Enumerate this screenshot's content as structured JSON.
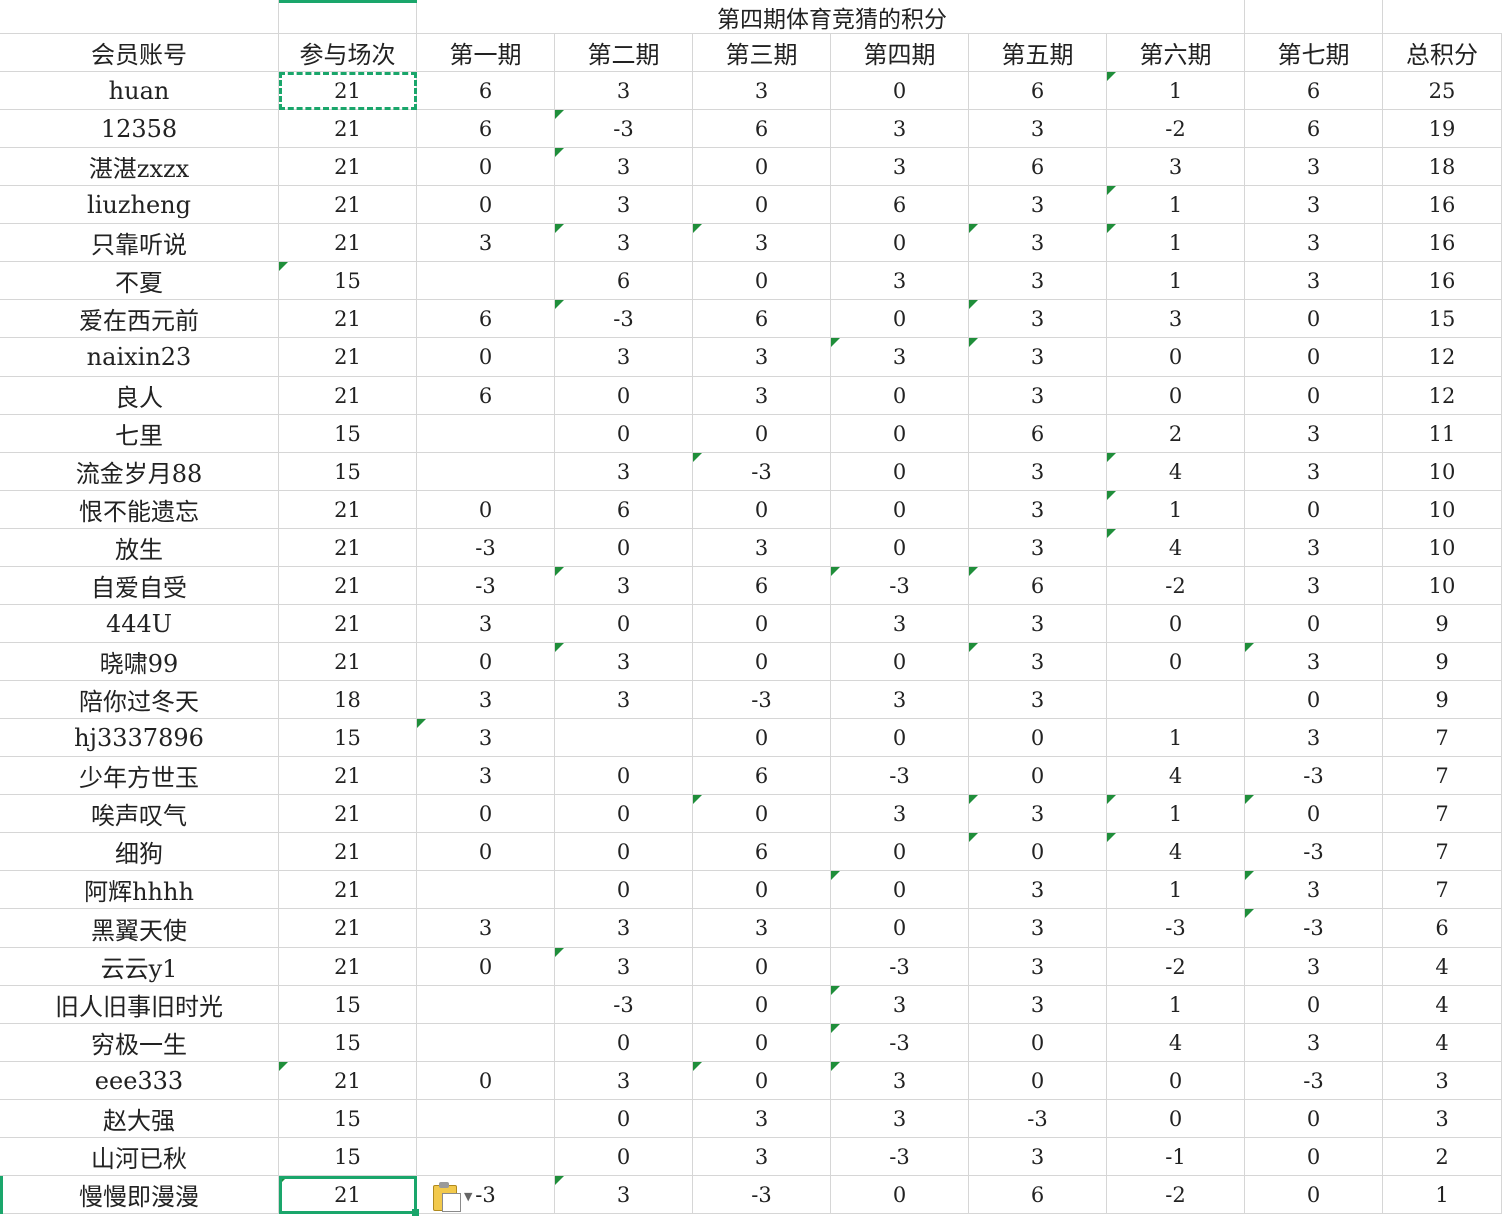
{
  "sheet": {
    "title": "第四期体育竞猜的积分",
    "headers": [
      "会员账号",
      "参与场次",
      "第一期",
      "第二期",
      "第三期",
      "第四期",
      "第五期",
      "第六期",
      "第七期",
      "总积分"
    ],
    "rows": [
      [
        "huan",
        "21",
        "6",
        "3",
        "3",
        "0",
        "6",
        "1",
        "6",
        "25"
      ],
      [
        "12358",
        "21",
        "6",
        "-3",
        "6",
        "3",
        "3",
        "-2",
        "6",
        "19"
      ],
      [
        "湛湛zxzx",
        "21",
        "0",
        "3",
        "0",
        "3",
        "6",
        "3",
        "3",
        "18"
      ],
      [
        "liuzheng",
        "21",
        "0",
        "3",
        "0",
        "6",
        "3",
        "1",
        "3",
        "16"
      ],
      [
        "只靠听说",
        "21",
        "3",
        "3",
        "3",
        "0",
        "3",
        "1",
        "3",
        "16"
      ],
      [
        "不夏",
        "15",
        "",
        "6",
        "0",
        "3",
        "3",
        "1",
        "3",
        "16"
      ],
      [
        "爱在西元前",
        "21",
        "6",
        "-3",
        "6",
        "0",
        "3",
        "3",
        "0",
        "15"
      ],
      [
        "naixin23",
        "21",
        "0",
        "3",
        "3",
        "3",
        "3",
        "0",
        "0",
        "12"
      ],
      [
        "良人",
        "21",
        "6",
        "0",
        "3",
        "0",
        "3",
        "0",
        "0",
        "12"
      ],
      [
        "七里",
        "15",
        "",
        "0",
        "0",
        "0",
        "6",
        "2",
        "3",
        "11"
      ],
      [
        "流金岁月88",
        "15",
        "",
        "3",
        "-3",
        "0",
        "3",
        "4",
        "3",
        "10"
      ],
      [
        "恨不能遗忘",
        "21",
        "0",
        "6",
        "0",
        "0",
        "3",
        "1",
        "0",
        "10"
      ],
      [
        "放生",
        "21",
        "-3",
        "0",
        "3",
        "0",
        "3",
        "4",
        "3",
        "10"
      ],
      [
        "自爱自受",
        "21",
        "-3",
        "3",
        "6",
        "-3",
        "6",
        "-2",
        "3",
        "10"
      ],
      [
        "444U",
        "21",
        "3",
        "0",
        "0",
        "3",
        "3",
        "0",
        "0",
        "9"
      ],
      [
        "晓啸99",
        "21",
        "0",
        "3",
        "0",
        "0",
        "3",
        "0",
        "3",
        "9"
      ],
      [
        "陪你过冬天",
        "18",
        "3",
        "3",
        "-3",
        "3",
        "3",
        "",
        "0",
        "9"
      ],
      [
        "hj3337896",
        "15",
        "3",
        "",
        "0",
        "0",
        "0",
        "1",
        "3",
        "7"
      ],
      [
        "少年方世玉",
        "21",
        "3",
        "0",
        "6",
        "-3",
        "0",
        "4",
        "-3",
        "7"
      ],
      [
        "唉声叹气",
        "21",
        "0",
        "0",
        "0",
        "3",
        "3",
        "1",
        "0",
        "7"
      ],
      [
        "细狗",
        "21",
        "0",
        "0",
        "6",
        "0",
        "0",
        "4",
        "-3",
        "7"
      ],
      [
        "阿辉hhhh",
        "21",
        "",
        "0",
        "0",
        "0",
        "3",
        "1",
        "3",
        "7"
      ],
      [
        "黑翼天使",
        "21",
        "3",
        "3",
        "3",
        "0",
        "3",
        "-3",
        "-3",
        "6"
      ],
      [
        "云云y1",
        "21",
        "0",
        "3",
        "0",
        "-3",
        "3",
        "-2",
        "3",
        "4"
      ],
      [
        "旧人旧事旧时光",
        "15",
        "",
        "-3",
        "0",
        "3",
        "3",
        "1",
        "0",
        "4"
      ],
      [
        "穷极一生",
        "15",
        "",
        "0",
        "0",
        "-3",
        "0",
        "4",
        "3",
        "4"
      ],
      [
        "eee333",
        "21",
        "0",
        "3",
        "0",
        "3",
        "0",
        "0",
        "-3",
        "3"
      ],
      [
        "赵大强",
        "15",
        "",
        "0",
        "3",
        "3",
        "-3",
        "0",
        "0",
        "3"
      ],
      [
        "山河已秋",
        "15",
        "",
        "0",
        "3",
        "-3",
        "3",
        "-1",
        "0",
        "2"
      ],
      [
        "慢慢即漫漫",
        "21",
        "-3",
        "3",
        "-3",
        "0",
        "6",
        "-2",
        "0",
        "1"
      ]
    ],
    "comment_marks": [
      [
        1,
        7
      ],
      [
        2,
        3
      ],
      [
        3,
        3
      ],
      [
        4,
        7
      ],
      [
        5,
        3
      ],
      [
        5,
        4
      ],
      [
        5,
        6
      ],
      [
        5,
        7
      ],
      [
        6,
        1
      ],
      [
        7,
        3
      ],
      [
        7,
        6
      ],
      [
        8,
        5
      ],
      [
        8,
        6
      ],
      [
        11,
        4
      ],
      [
        11,
        7
      ],
      [
        12,
        7
      ],
      [
        13,
        7
      ],
      [
        14,
        3
      ],
      [
        14,
        5
      ],
      [
        14,
        6
      ],
      [
        16,
        3
      ],
      [
        16,
        6
      ],
      [
        16,
        8
      ],
      [
        18,
        2
      ],
      [
        20,
        4
      ],
      [
        20,
        6
      ],
      [
        20,
        7
      ],
      [
        20,
        8
      ],
      [
        21,
        6
      ],
      [
        21,
        7
      ],
      [
        22,
        5
      ],
      [
        22,
        8
      ],
      [
        23,
        8
      ],
      [
        24,
        3
      ],
      [
        25,
        5
      ],
      [
        26,
        5
      ],
      [
        27,
        1
      ],
      [
        27,
        4
      ],
      [
        27,
        5
      ],
      [
        30,
        1
      ],
      [
        30,
        3
      ]
    ],
    "colors": {
      "grid": "#d6d6d6",
      "selection": "#1aa66b",
      "comment_triangle": "#1f8e3a"
    },
    "paste_options_icon": "clipboard-icon"
  }
}
